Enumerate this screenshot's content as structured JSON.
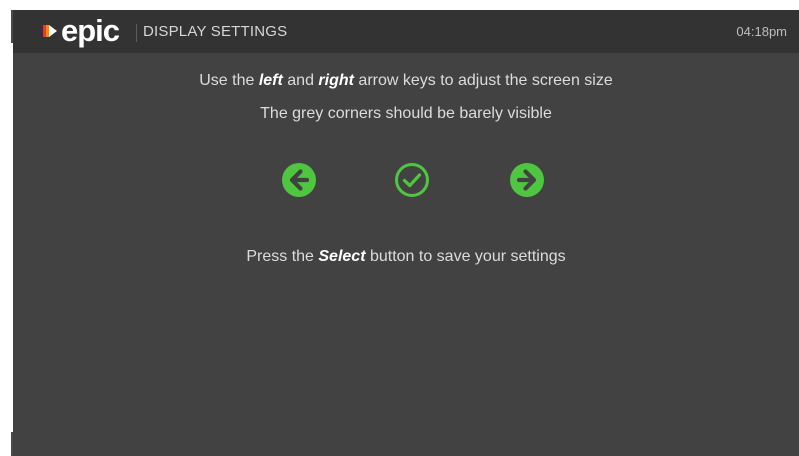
{
  "header": {
    "brand": "epic",
    "title": "DISPLAY SETTINGS",
    "time": "04:18pm"
  },
  "instructions": {
    "line1": {
      "pre": "Use the ",
      "em1": "left",
      "mid": " and ",
      "em2": "right",
      "post": " arrow keys to adjust the screen size"
    },
    "line2": "The grey corners should be barely visible",
    "line3": {
      "pre": "Press the ",
      "em": "Select",
      "post": " button to save your settings"
    }
  },
  "controls": {
    "accent": "#4fc640",
    "icons": [
      "arrow-left-icon",
      "check-circle-icon",
      "arrow-right-icon"
    ]
  }
}
